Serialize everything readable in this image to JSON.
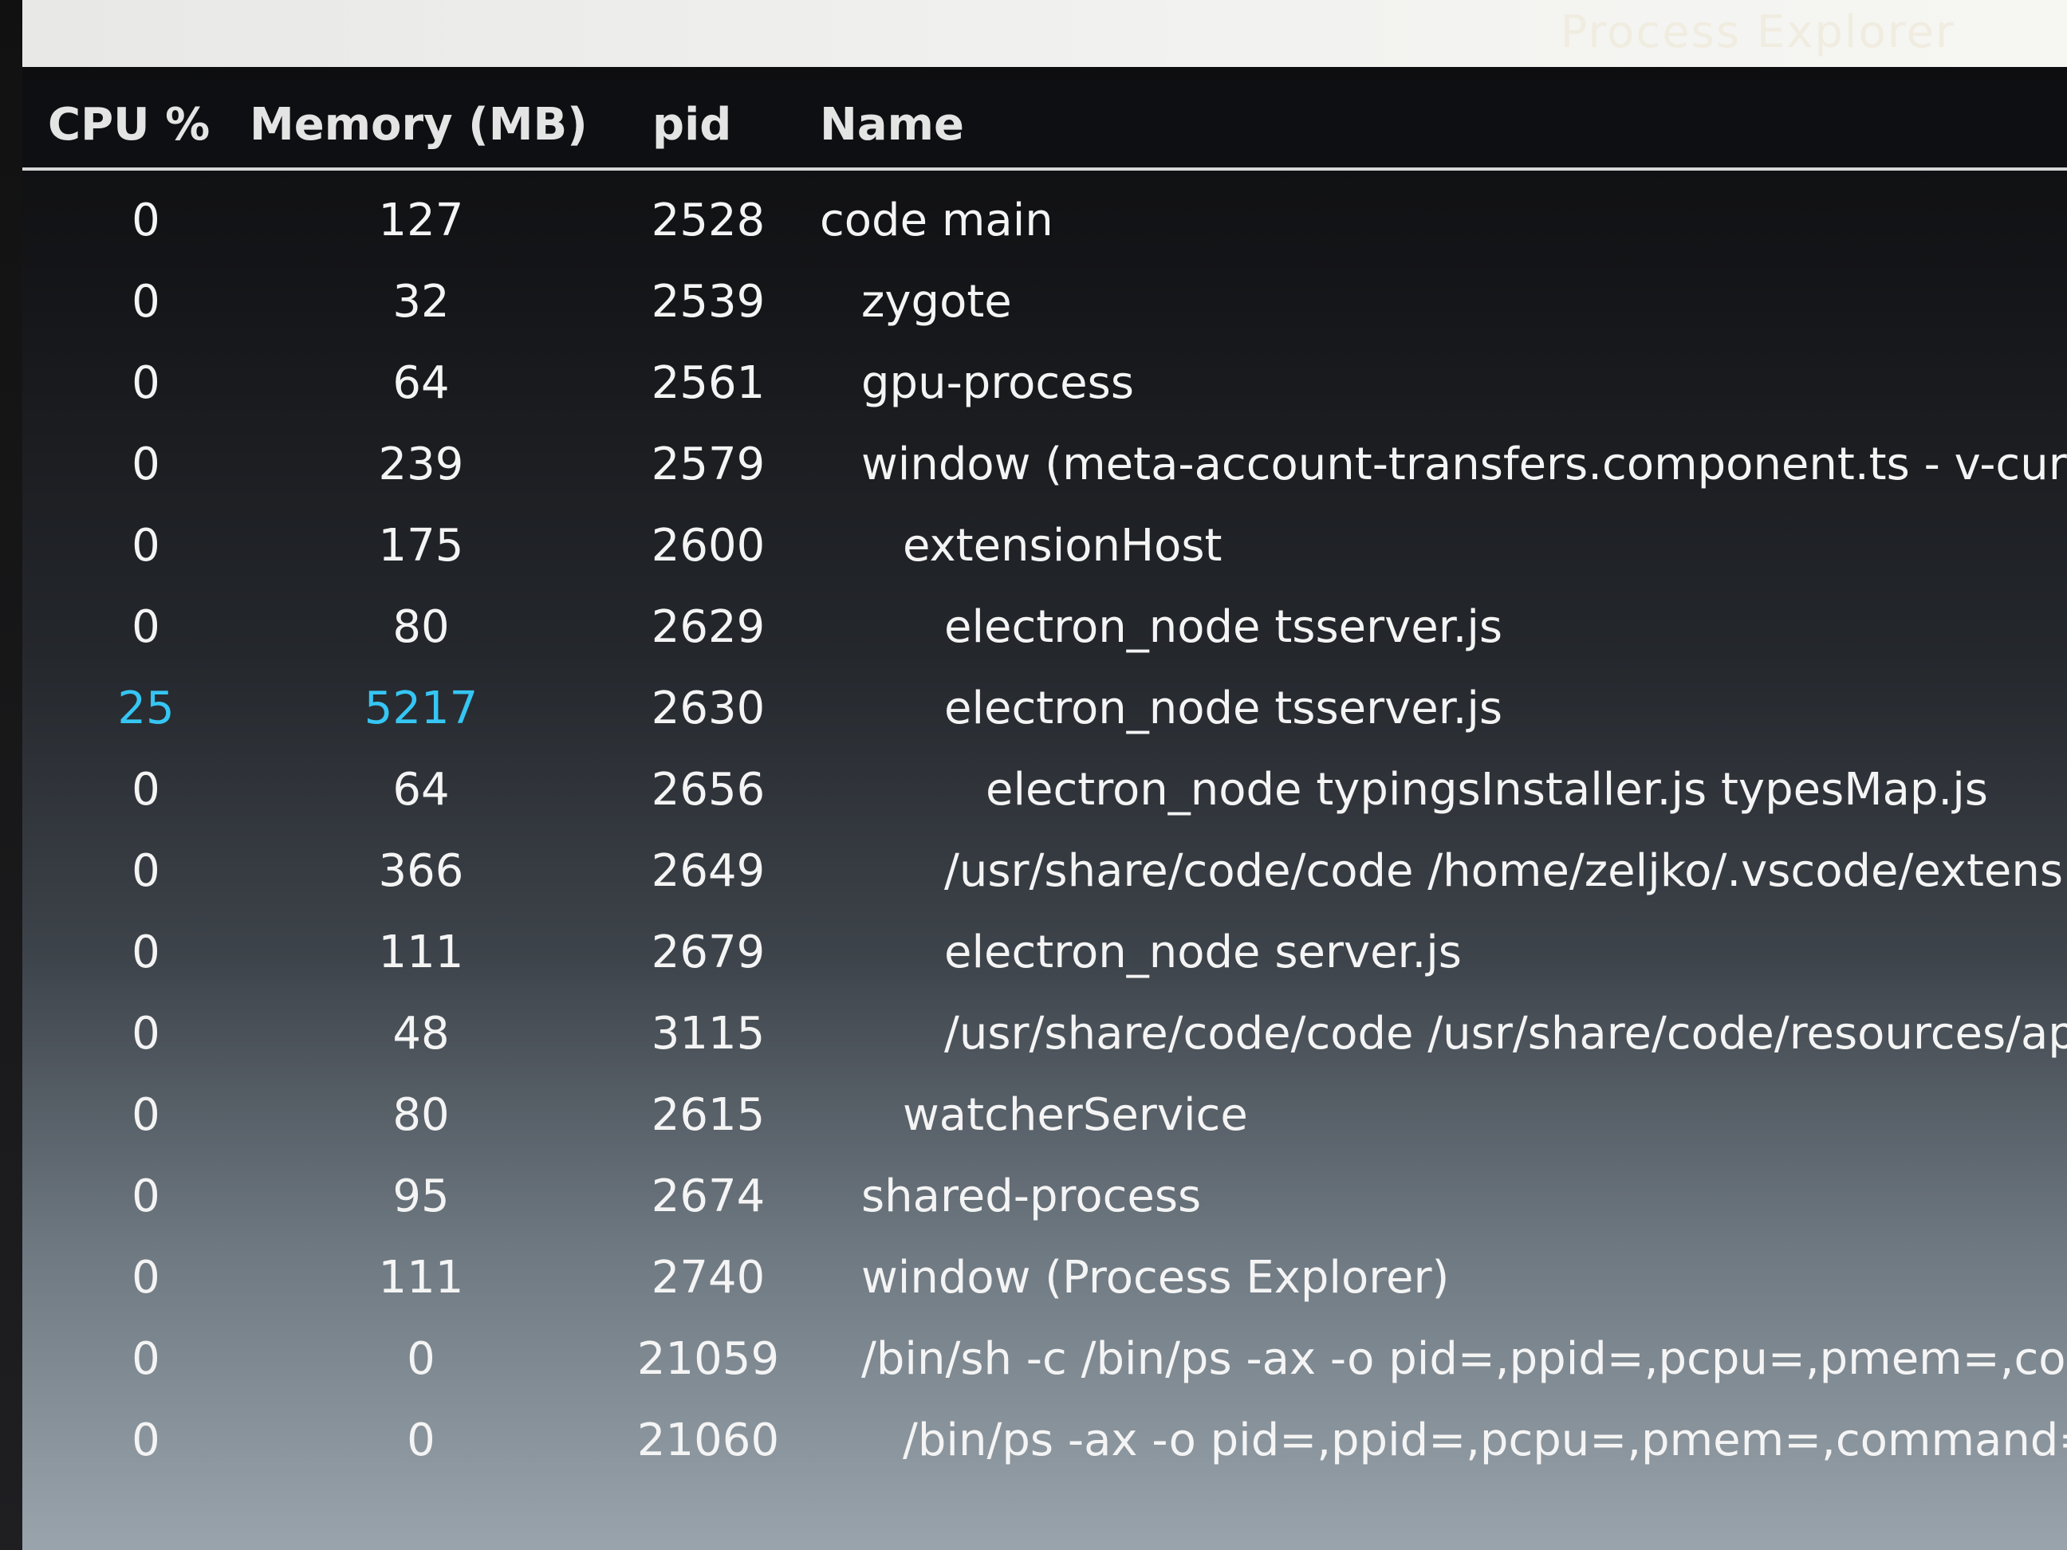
{
  "window": {
    "title": "Process Explorer"
  },
  "columns": {
    "cpu": "CPU %",
    "memory": "Memory (MB)",
    "pid": "pid",
    "name": "Name"
  },
  "colors": {
    "highlight": "#35c6f4"
  },
  "processes": [
    {
      "cpu": "0",
      "memory": "127",
      "pid": "2528",
      "name": "code main",
      "depth": 0
    },
    {
      "cpu": "0",
      "memory": "32",
      "pid": "2539",
      "name": "zygote",
      "depth": 1
    },
    {
      "cpu": "0",
      "memory": "64",
      "pid": "2561",
      "name": "gpu-process",
      "depth": 1
    },
    {
      "cpu": "0",
      "memory": "239",
      "pid": "2579",
      "name": "window (meta-account-transfers.component.ts - v-curre",
      "depth": 1
    },
    {
      "cpu": "0",
      "memory": "175",
      "pid": "2600",
      "name": "extensionHost",
      "depth": 2
    },
    {
      "cpu": "0",
      "memory": "80",
      "pid": "2629",
      "name": "electron_node tsserver.js",
      "depth": 3
    },
    {
      "cpu": "25",
      "memory": "5217",
      "pid": "2630",
      "name": "electron_node tsserver.js",
      "depth": 3,
      "highlight": true
    },
    {
      "cpu": "0",
      "memory": "64",
      "pid": "2656",
      "name": "electron_node typingsInstaller.js typesMap.js",
      "depth": 4
    },
    {
      "cpu": "0",
      "memory": "366",
      "pid": "2649",
      "name": "/usr/share/code/code /home/zeljko/.vscode/extensio",
      "depth": 3
    },
    {
      "cpu": "0",
      "memory": "111",
      "pid": "2679",
      "name": "electron_node server.js",
      "depth": 3
    },
    {
      "cpu": "0",
      "memory": "48",
      "pid": "3115",
      "name": "/usr/share/code/code /usr/share/code/resources/app/",
      "depth": 3
    },
    {
      "cpu": "0",
      "memory": "80",
      "pid": "2615",
      "name": "watcherService",
      "depth": 2
    },
    {
      "cpu": "0",
      "memory": "95",
      "pid": "2674",
      "name": "shared-process",
      "depth": 1
    },
    {
      "cpu": "0",
      "memory": "111",
      "pid": "2740",
      "name": "window (Process Explorer)",
      "depth": 1
    },
    {
      "cpu": "0",
      "memory": "0",
      "pid": "21059",
      "name": "/bin/sh -c /bin/ps -ax -o pid=,ppid=,pcpu=,pmem=,command",
      "depth": 1
    },
    {
      "cpu": "0",
      "memory": "0",
      "pid": "21060",
      "name": "/bin/ps -ax -o pid=,ppid=,pcpu=,pmem=,command=",
      "depth": 2
    }
  ]
}
